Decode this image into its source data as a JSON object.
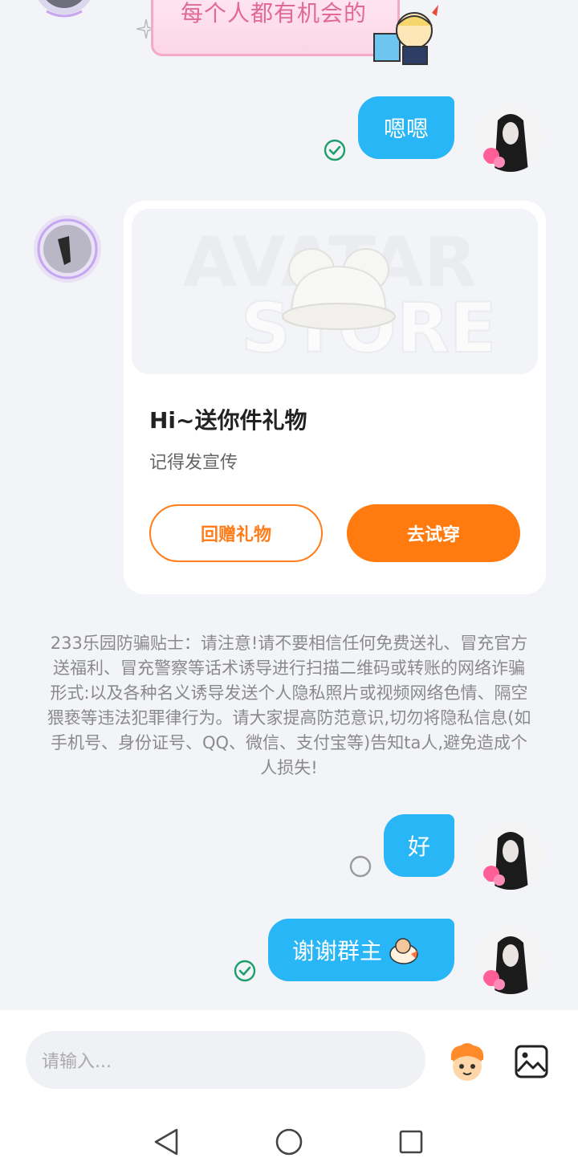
{
  "colors": {
    "accent_blue": "#29b6f6",
    "accent_orange": "#ff7a0f",
    "check_green": "#1e9e6b"
  },
  "top_sticker": {
    "text": "每个人都有机会的"
  },
  "messages": [
    {
      "side": "right",
      "text": "嗯嗯",
      "status": "sent-check-icon"
    },
    {
      "side": "right",
      "text": "好",
      "status": "pending-circle-icon"
    },
    {
      "side": "right",
      "text": "谢谢群主",
      "status": "sent-check-icon"
    }
  ],
  "gift_card": {
    "title": "Hi~送你件礼物",
    "subtitle": "记得发宣传",
    "return_gift_label": "回赠礼物",
    "try_on_label": "去试穿"
  },
  "notice": "233乐园防骗贴士：请注意!请不要相信任何免费送礼、冒充官方送福利、冒充警察等话术诱导进行扫描二维码或转账的网络诈骗形式:以及各种名义诱导发送个人隐私照片或视频网络色情、隔空猥亵等违法犯罪律行为。请大家提高防范意识,切勿将隐私信息(如手机号、身份证号、QQ、微信、支付宝等)告知ta人,避免造成个人损失!",
  "input": {
    "placeholder": "请输入..."
  }
}
